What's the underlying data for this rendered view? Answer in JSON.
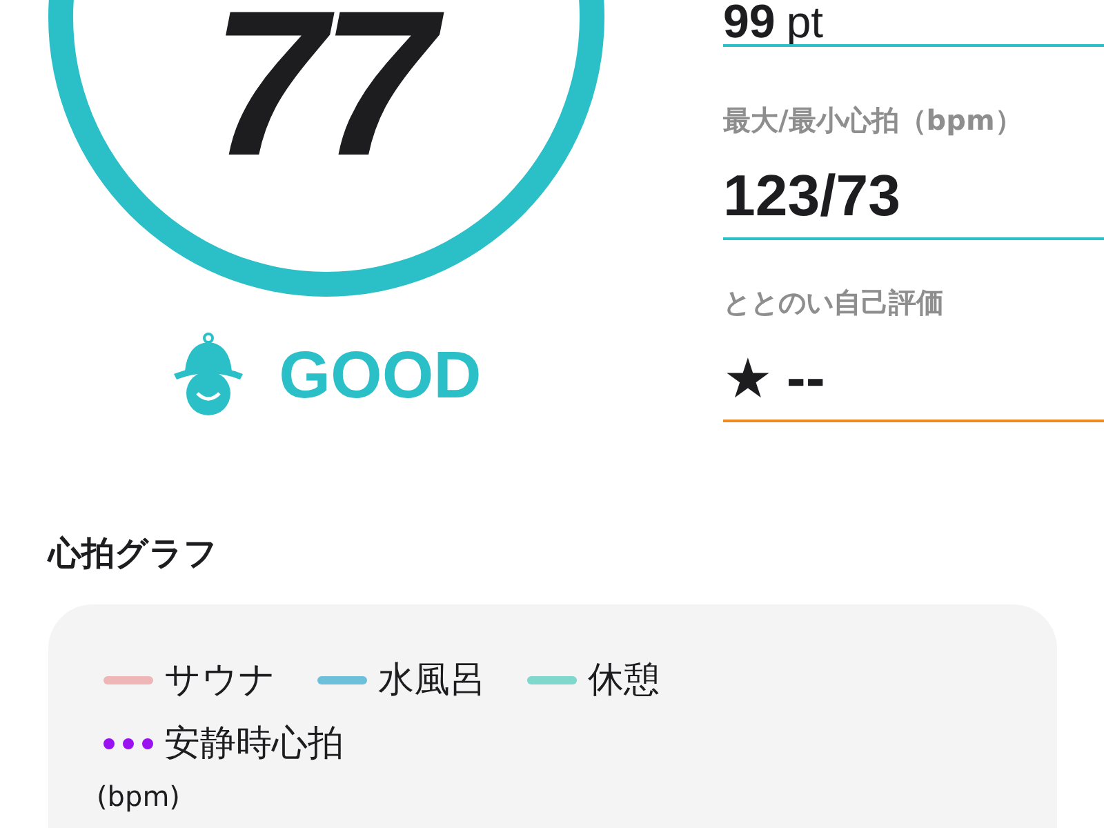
{
  "score": {
    "value": "77",
    "rating": "GOOD"
  },
  "stats": [
    {
      "value": "99",
      "unit": "pt",
      "color": "#2bbfc8"
    },
    {
      "label": "最大/最小心拍（bpm）",
      "value": "123/73",
      "color": "#2bbfc8"
    },
    {
      "label": "ととのい自己評価",
      "star": "★",
      "value": "--",
      "color": "#ee8a22"
    }
  ],
  "graph": {
    "title": "心拍グラフ",
    "legend": [
      {
        "label": "サウナ",
        "kind": "solid",
        "color": "#eeb6b6"
      },
      {
        "label": "水風呂",
        "kind": "solid",
        "color": "#6cc0da"
      },
      {
        "label": "休憩",
        "kind": "solid",
        "color": "#80d8cc"
      },
      {
        "label": "安静時心拍",
        "kind": "dotted",
        "color": "#9b12f0"
      }
    ],
    "unit": "(bpm)"
  }
}
